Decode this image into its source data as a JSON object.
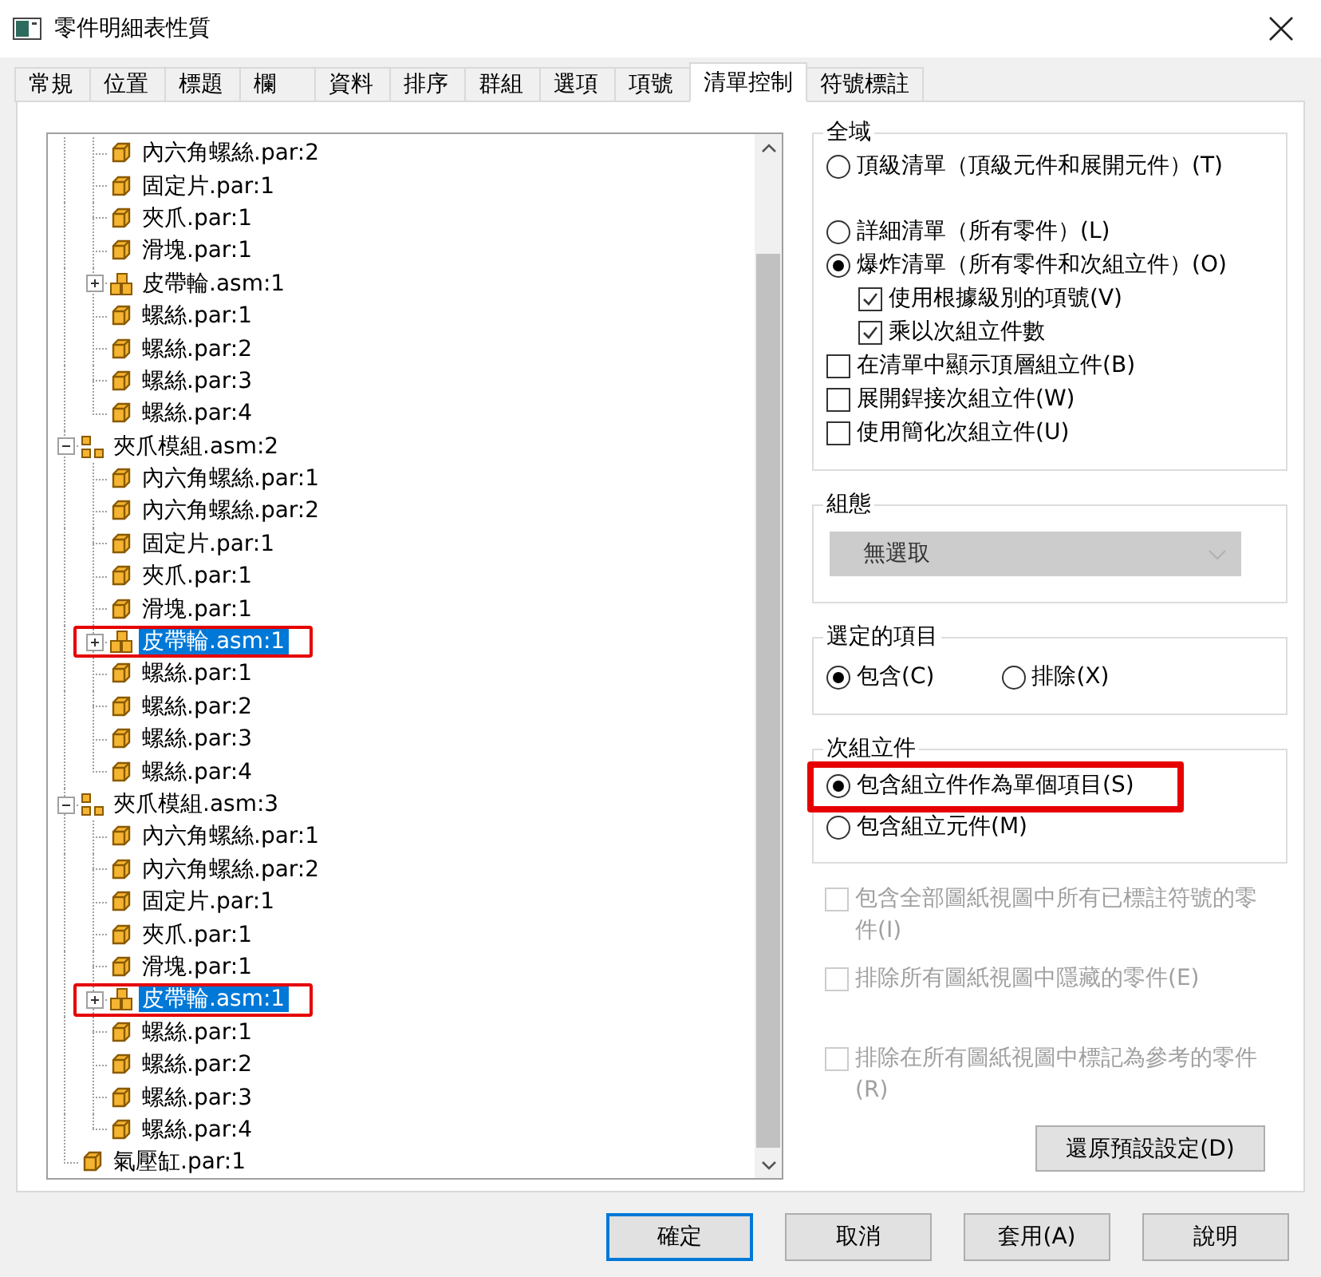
{
  "window": {
    "title": "零件明細表性質"
  },
  "tabs": [
    {
      "label": "常規",
      "selected": false
    },
    {
      "label": "位置",
      "selected": false
    },
    {
      "label": "標題",
      "selected": false
    },
    {
      "label": "欄",
      "selected": false
    },
    {
      "label": "資料",
      "selected": false
    },
    {
      "label": "排序",
      "selected": false
    },
    {
      "label": "群組",
      "selected": false
    },
    {
      "label": "選項",
      "selected": false
    },
    {
      "label": "項號",
      "selected": false
    },
    {
      "label": "清單控制",
      "selected": true
    },
    {
      "label": "符號標註",
      "selected": false
    }
  ],
  "tree": {
    "items": [
      {
        "kind": "continued",
        "children": [
          {
            "kind": "part",
            "label": "內六角螺絲.par:2",
            "selected": false
          },
          {
            "kind": "part",
            "label": "固定片.par:1",
            "selected": false
          },
          {
            "kind": "part",
            "label": "夾爪.par:1",
            "selected": false
          },
          {
            "kind": "part",
            "label": "滑塊.par:1",
            "selected": false
          },
          {
            "kind": "subassembly",
            "label": "皮帶輪.asm:1",
            "selected": false,
            "expanded": false
          },
          {
            "kind": "part",
            "label": "螺絲.par:1",
            "selected": false
          },
          {
            "kind": "part",
            "label": "螺絲.par:2",
            "selected": false
          },
          {
            "kind": "part",
            "label": "螺絲.par:3",
            "selected": false
          },
          {
            "kind": "part",
            "label": "螺絲.par:4",
            "selected": false
          }
        ]
      },
      {
        "kind": "assembly",
        "label": "夾爪模組.asm:2",
        "selected": false,
        "expanded": true,
        "children": [
          {
            "kind": "part",
            "label": "內六角螺絲.par:1",
            "selected": false
          },
          {
            "kind": "part",
            "label": "內六角螺絲.par:2",
            "selected": false
          },
          {
            "kind": "part",
            "label": "固定片.par:1",
            "selected": false
          },
          {
            "kind": "part",
            "label": "夾爪.par:1",
            "selected": false
          },
          {
            "kind": "part",
            "label": "滑塊.par:1",
            "selected": false
          },
          {
            "kind": "subassembly",
            "label": "皮帶輪.asm:1",
            "selected": true,
            "expanded": false,
            "highlighted": true
          },
          {
            "kind": "part",
            "label": "螺絲.par:1",
            "selected": false
          },
          {
            "kind": "part",
            "label": "螺絲.par:2",
            "selected": false
          },
          {
            "kind": "part",
            "label": "螺絲.par:3",
            "selected": false
          },
          {
            "kind": "part",
            "label": "螺絲.par:4",
            "selected": false
          }
        ]
      },
      {
        "kind": "assembly",
        "label": "夾爪模組.asm:3",
        "selected": false,
        "expanded": true,
        "children": [
          {
            "kind": "part",
            "label": "內六角螺絲.par:1",
            "selected": false
          },
          {
            "kind": "part",
            "label": "內六角螺絲.par:2",
            "selected": false
          },
          {
            "kind": "part",
            "label": "固定片.par:1",
            "selected": false
          },
          {
            "kind": "part",
            "label": "夾爪.par:1",
            "selected": false
          },
          {
            "kind": "part",
            "label": "滑塊.par:1",
            "selected": false
          },
          {
            "kind": "subassembly",
            "label": "皮帶輪.asm:1",
            "selected": true,
            "expanded": false,
            "highlighted": true
          },
          {
            "kind": "part",
            "label": "螺絲.par:1",
            "selected": false
          },
          {
            "kind": "part",
            "label": "螺絲.par:2",
            "selected": false
          },
          {
            "kind": "part",
            "label": "螺絲.par:3",
            "selected": false
          },
          {
            "kind": "part",
            "label": "螺絲.par:4",
            "selected": false
          }
        ]
      },
      {
        "kind": "part",
        "label": "氣壓缸.par:1",
        "selected": false
      }
    ]
  },
  "global_group": {
    "title": "全域",
    "options": [
      {
        "kind": "radio",
        "label": "頂級清單（頂級元件和展開元件）(T)",
        "selected": false
      },
      {
        "kind": "radio",
        "label": "詳細清單（所有零件）(L)",
        "selected": false
      },
      {
        "kind": "radio",
        "label": "爆炸清單（所有零件和次組立件）(O)",
        "selected": true,
        "children": [
          {
            "kind": "checkbox",
            "label": "使用根據級別的項號(V)",
            "checked": true
          },
          {
            "kind": "checkbox",
            "label": "乘以次組立件數",
            "checked": true
          }
        ]
      },
      {
        "kind": "checkbox",
        "label": "在清單中顯示頂層組立件(B)",
        "checked": false
      },
      {
        "kind": "checkbox",
        "label": "展開銲接次組立件(W)",
        "checked": false
      },
      {
        "kind": "checkbox",
        "label": "使用簡化次組立件(U)",
        "checked": false
      }
    ]
  },
  "configuration_group": {
    "title": "組態",
    "dropdown": {
      "value": "無選取",
      "disabled": true
    }
  },
  "selected_items_group": {
    "title": "選定的項目",
    "options": [
      {
        "label": "包含(C)",
        "selected": true
      },
      {
        "label": "排除(X)",
        "selected": false
      }
    ]
  },
  "subassembly_group": {
    "title": "次組立件",
    "options": [
      {
        "label": "包含組立件作為單個項目(S)",
        "selected": true,
        "highlighted": true
      },
      {
        "label": "包含組立元件(M)",
        "selected": false
      }
    ]
  },
  "extra_options": [
    {
      "label": "包含全部圖紙視圖中所有已標註符號的零件(I)",
      "checked": false,
      "disabled": true
    },
    {
      "label": "排除所有圖紙視圖中隱藏的零件(E)",
      "checked": false,
      "disabled": true
    },
    {
      "label": "排除在所有圖紙視圖中標記為參考的零件(R)",
      "checked": false,
      "disabled": true
    }
  ],
  "restore_button": "還原預設設定(D)",
  "buttons": [
    {
      "label": "確定",
      "default": true
    },
    {
      "label": "取消",
      "default": false
    },
    {
      "label": "套用(A)",
      "default": false
    },
    {
      "label": "說明",
      "default": false
    }
  ]
}
